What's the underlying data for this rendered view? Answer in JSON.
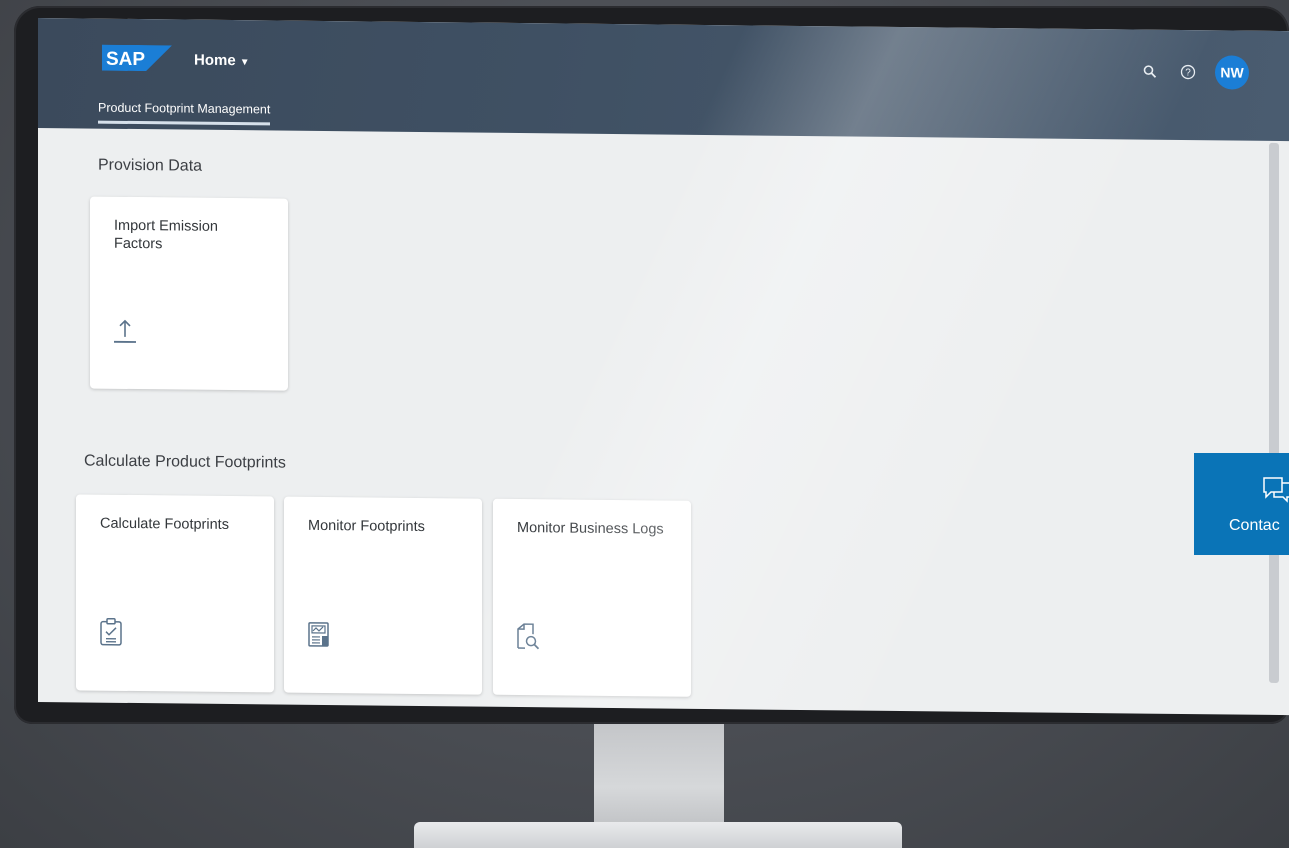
{
  "shell": {
    "logo_text": "SAP",
    "home_label": "Home",
    "tab_label": "Product Footprint Management",
    "user_initials": "NW"
  },
  "sections": [
    {
      "title": "Provision Data",
      "tiles": [
        {
          "title": "Import Emission Factors",
          "icon": "upload-icon"
        }
      ]
    },
    {
      "title": "Calculate Product Footprints",
      "tiles": [
        {
          "title": "Calculate Footprints",
          "icon": "clipboard-check-icon"
        },
        {
          "title": "Monitor Footprints",
          "icon": "report-chart-icon"
        },
        {
          "title": "Monitor Business Logs",
          "icon": "document-search-icon"
        }
      ]
    }
  ],
  "contact": {
    "label": "Contac"
  },
  "colors": {
    "shell": "#3f5063",
    "accent": "#1b7ed6",
    "contact": "#0a74b7",
    "icon": "#5b738b"
  }
}
